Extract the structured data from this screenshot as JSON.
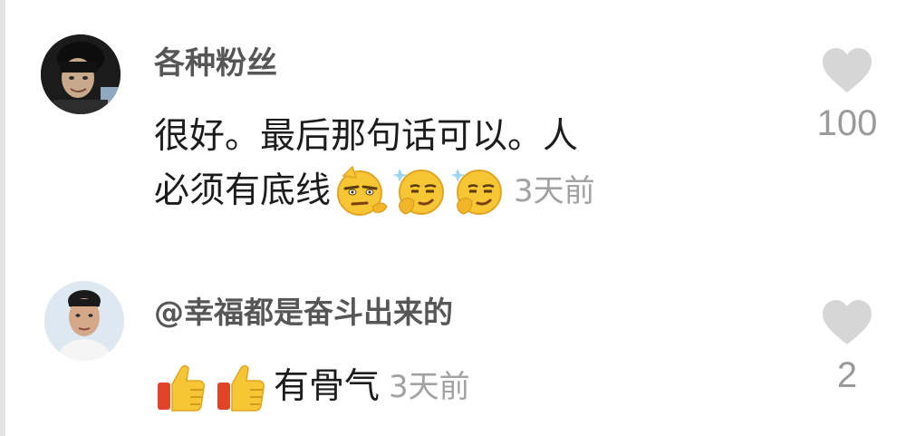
{
  "comments": [
    {
      "username": "各种粉丝",
      "text_line1": "很好。最后那句话可以。人",
      "text_line2": "必须有底线",
      "emojis": [
        "smirk-emoji",
        "thinking-emoji",
        "thinking-emoji"
      ],
      "time": "3天前",
      "likes": "100"
    },
    {
      "username": "@幸福都是奋斗出来的",
      "thumbs": [
        "thumbs-up-emoji",
        "thumbs-up-emoji"
      ],
      "text": "有骨气",
      "time": "3天前",
      "likes": "2"
    }
  ],
  "colors": {
    "username": "#565656",
    "text": "#1c1c1c",
    "time": "#a2a2a2",
    "heart": "#d6d6d6",
    "emoji_yellow": "#f7c634"
  }
}
